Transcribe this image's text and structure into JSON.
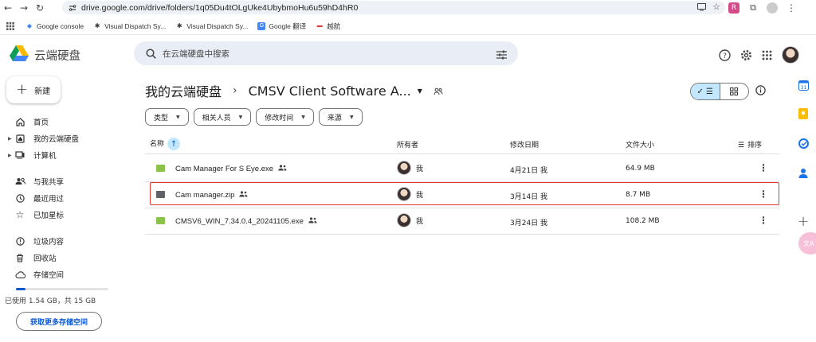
{
  "browser": {
    "url": "drive.google.com/drive/folders/1q05Du4tOLgUke4UbybmoHu6u59hD4hR0",
    "bookmarks": [
      {
        "label": "Google console",
        "icon": "google-cloud-icon"
      },
      {
        "label": "Visual Dispatch Sy...",
        "icon": "app-icon"
      },
      {
        "label": "Visual Dispatch Sy...",
        "icon": "app-icon"
      },
      {
        "label": "Google 翻译",
        "icon": "translate-icon"
      },
      {
        "label": "越航",
        "icon": "airline-icon"
      }
    ]
  },
  "header": {
    "brand": "云端硬盘",
    "search_placeholder": "在云端硬盘中搜索"
  },
  "sidebar": {
    "new_label": "新建",
    "items": [
      {
        "label": "首页",
        "icon": "home-icon"
      },
      {
        "label": "我的云端硬盘",
        "icon": "my-drive-icon"
      },
      {
        "label": "计算机",
        "icon": "computer-icon"
      },
      {
        "label": "与我共享",
        "icon": "shared-icon"
      },
      {
        "label": "最近用过",
        "icon": "clock-icon"
      },
      {
        "label": "已加星标",
        "icon": "star-icon"
      },
      {
        "label": "垃圾内容",
        "icon": "spam-icon"
      },
      {
        "label": "回收站",
        "icon": "trash-icon"
      },
      {
        "label": "存储空间",
        "icon": "cloud-icon"
      }
    ],
    "storage_fraction": 0.1,
    "storage_text": "已使用 1.54 GB，共 15 GB",
    "get_storage_label": "获取更多存储空间"
  },
  "main": {
    "breadcrumb_root": "我的云端硬盘",
    "breadcrumb_current": "CMSV Client Software A...",
    "filters": [
      "类型",
      "相关人员",
      "修改时间",
      "来源"
    ],
    "columns": {
      "name": "名称",
      "owner": "所有者",
      "modified": "修改日期",
      "size": "文件大小",
      "sort": "排序"
    },
    "rows": [
      {
        "name": "Cam Manager For S Eye.exe",
        "owner": "我",
        "modified": "4月21日 我",
        "size": "64.9 MB",
        "icon_color": "#8bc34a"
      },
      {
        "name": "Cam manager.zip",
        "owner": "我",
        "modified": "3月14日 我",
        "size": "8.7 MB",
        "icon_color": "#5f6368"
      },
      {
        "name": "CMSV6_WIN_7.34.0.4_20241105.exe",
        "owner": "我",
        "modified": "3月24日 我",
        "size": "108.2 MB",
        "icon_color": "#8bc34a"
      }
    ]
  },
  "colors": {
    "accent": "#0b57d0",
    "highlight": "#e53935",
    "search_bg": "#e9eef6"
  }
}
